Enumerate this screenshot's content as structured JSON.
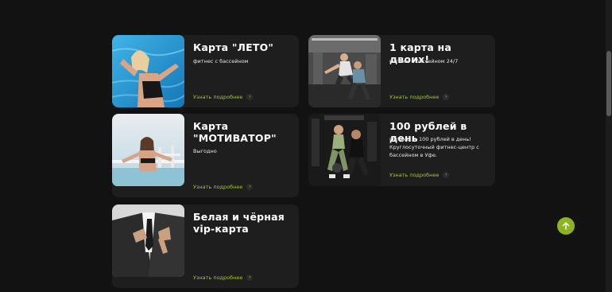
{
  "cards": [
    {
      "title": "Карта \"ЛЕТО\"",
      "description": "фитнес с бассейном",
      "link_label": "Узнать подробнее",
      "image_alt": "Девушка у бассейна"
    },
    {
      "title": "1 карта на двоих!",
      "description": "Фитнес с бассейном 24/7",
      "link_label": "Узнать подробнее",
      "image_alt": "Пара тренируется в зале"
    },
    {
      "title": "Карта \"МОТИВАТОР\"",
      "description": "Выгодно",
      "link_label": "Узнать подробнее",
      "image_alt": "Девушка у бортика бассейна"
    },
    {
      "title": "100 рублей в день",
      "description": "Фитнес за 100 рублей в день! Круглосуточный фитнес-центр с бассейном в Уфе.",
      "link_label": "Узнать подробнее",
      "image_alt": "Тренировка с гирями"
    },
    {
      "title": "Белая и чёрная vip-карта",
      "description": "",
      "link_label": "Узнать подробнее",
      "image_alt": "Мужчина в костюме"
    }
  ],
  "colors": {
    "accent": "#9fc63a",
    "button": "#8cb421",
    "card_bg": "#1e1e1e",
    "page_bg": "#121212"
  },
  "icons": {
    "link_arrow": "chevron-right-icon",
    "scroll_top": "arrow-up-icon"
  }
}
